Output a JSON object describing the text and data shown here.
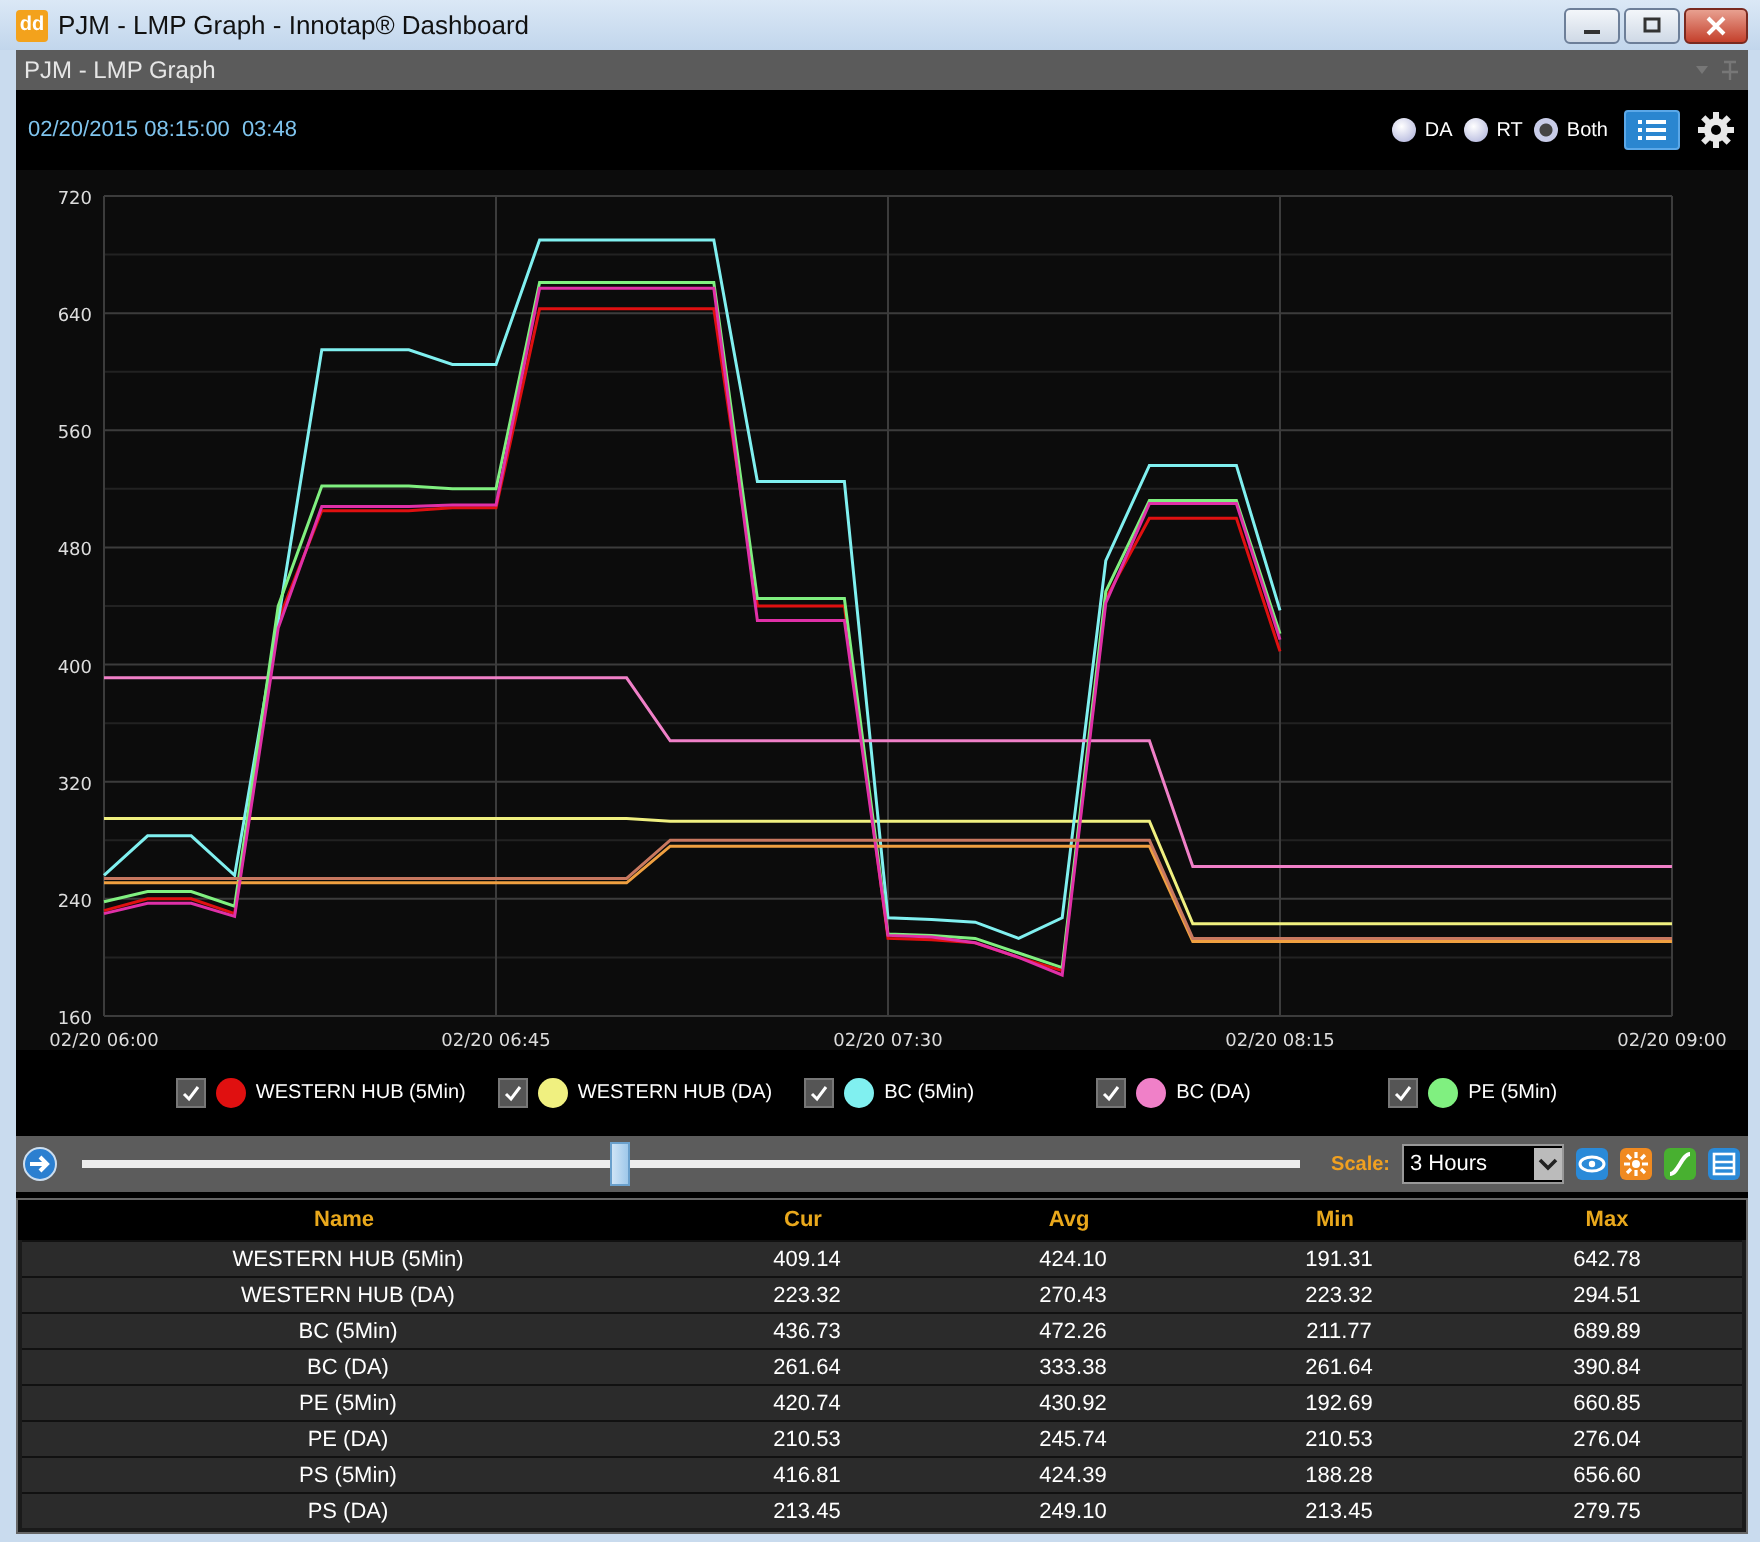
{
  "window": {
    "logo": "dd",
    "title": "PJM - LMP Graph - Innotap® Dashboard"
  },
  "panel": {
    "title": "PJM - LMP Graph"
  },
  "toolbar": {
    "timestamp": "02/20/2015 08:15:00",
    "elapsed": "03:48",
    "modes": [
      {
        "label": "DA",
        "selected": false
      },
      {
        "label": "RT",
        "selected": false
      },
      {
        "label": "Both",
        "selected": true
      }
    ]
  },
  "chart_data": {
    "type": "line",
    "categories": [
      "02/20 06:00",
      null,
      null,
      null,
      null,
      null,
      null,
      null,
      null,
      "02/20 06:45",
      null,
      null,
      null,
      null,
      null,
      null,
      null,
      null,
      "02/20 07:30",
      null,
      null,
      null,
      null,
      null,
      null,
      null,
      null,
      "02/20 08:15",
      null,
      null,
      null,
      null,
      null,
      null,
      null,
      null,
      "02/20 09:00"
    ],
    "ylim": [
      160,
      720
    ],
    "grid": true,
    "yticks": [
      160,
      240,
      320,
      400,
      480,
      560,
      640,
      720
    ],
    "series": [
      {
        "name": "WESTERN HUB (5Min)",
        "color": "#e01010",
        "values": [
          232,
          240,
          240,
          230,
          430,
          505,
          505,
          505,
          507,
          507,
          643,
          643,
          643,
          643,
          643,
          440,
          440,
          440,
          213,
          212,
          210,
          200,
          191,
          445,
          500,
          500,
          500,
          409,
          null,
          null,
          null,
          null,
          null,
          null,
          null,
          null,
          null
        ]
      },
      {
        "name": "WESTERN HUB (DA)",
        "color": "#f0f080",
        "values": [
          295,
          295,
          295,
          295,
          295,
          295,
          295,
          295,
          295,
          295,
          295,
          295,
          295,
          293,
          293,
          293,
          293,
          293,
          293,
          293,
          293,
          293,
          293,
          293,
          293,
          223,
          223,
          223,
          223,
          223,
          223,
          223,
          223,
          223,
          223,
          223,
          223
        ]
      },
      {
        "name": "BC (5Min)",
        "color": "#80f0f0",
        "values": [
          256,
          283,
          283,
          256,
          430,
          615,
          615,
          615,
          605,
          605,
          690,
          690,
          690,
          690,
          690,
          525,
          525,
          525,
          227,
          226,
          224,
          213,
          227,
          471,
          536,
          536,
          536,
          437,
          null,
          null,
          null,
          null,
          null,
          null,
          null,
          null,
          null
        ]
      },
      {
        "name": "BC (DA)",
        "color": "#f080c8",
        "values": [
          391,
          391,
          391,
          391,
          391,
          391,
          391,
          391,
          391,
          391,
          391,
          391,
          391,
          348,
          348,
          348,
          348,
          348,
          348,
          348,
          348,
          348,
          348,
          348,
          348,
          262,
          262,
          262,
          262,
          262,
          262,
          262,
          262,
          262,
          262,
          262,
          262
        ]
      },
      {
        "name": "PE (5Min)",
        "color": "#80f080",
        "values": [
          238,
          245,
          245,
          235,
          440,
          522,
          522,
          522,
          520,
          520,
          661,
          661,
          661,
          661,
          661,
          445,
          445,
          445,
          216,
          215,
          213,
          203,
          193,
          450,
          512,
          512,
          512,
          421,
          null,
          null,
          null,
          null,
          null,
          null,
          null,
          null,
          null
        ]
      },
      {
        "color": "#f0a040",
        "values": [
          251,
          251,
          251,
          251,
          251,
          251,
          251,
          251,
          251,
          251,
          251,
          251,
          251,
          276,
          276,
          276,
          276,
          276,
          276,
          276,
          276,
          276,
          276,
          276,
          276,
          211,
          211,
          211,
          211,
          211,
          211,
          211,
          211,
          211,
          211,
          211,
          211
        ]
      },
      {
        "color": "#e030a8",
        "values": [
          230,
          237,
          237,
          228,
          425,
          508,
          508,
          508,
          509,
          509,
          657,
          657,
          657,
          657,
          657,
          430,
          430,
          430,
          215,
          214,
          210,
          200,
          188,
          442,
          510,
          510,
          510,
          417,
          null,
          null,
          null,
          null,
          null,
          null,
          null,
          null,
          null
        ]
      },
      {
        "color": "#c87860",
        "values": [
          254,
          254,
          254,
          254,
          254,
          254,
          254,
          254,
          254,
          254,
          254,
          254,
          254,
          280,
          280,
          280,
          280,
          280,
          280,
          280,
          280,
          280,
          280,
          280,
          280,
          213,
          213,
          213,
          213,
          213,
          213,
          213,
          213,
          213,
          213,
          213,
          213
        ]
      }
    ]
  },
  "legend": [
    {
      "checked": true
    },
    {
      "checked": true
    },
    {
      "checked": true
    },
    {
      "checked": true
    },
    {
      "checked": true
    }
  ],
  "timeline": {
    "level": 0.44,
    "scale_label": "Scale:",
    "scale": "3 Hours"
  },
  "table": {
    "columns": [
      "Name",
      "Cur",
      "Avg",
      "Min",
      "Max"
    ],
    "rows": [
      [
        "WESTERN HUB (5Min)",
        "409.14",
        "424.10",
        "191.31",
        "642.78"
      ],
      [
        "WESTERN HUB (DA)",
        "223.32",
        "270.43",
        "223.32",
        "294.51"
      ],
      [
        "BC (5Min)",
        "436.73",
        "472.26",
        "211.77",
        "689.89"
      ],
      [
        "BC (DA)",
        "261.64",
        "333.38",
        "261.64",
        "390.84"
      ],
      [
        "PE (5Min)",
        "420.74",
        "430.92",
        "192.69",
        "660.85"
      ],
      [
        "PE (DA)",
        "210.53",
        "245.74",
        "210.53",
        "276.04"
      ],
      [
        "PS (5Min)",
        "416.81",
        "424.39",
        "188.28",
        "656.60"
      ],
      [
        "PS (DA)",
        "213.45",
        "249.10",
        "213.45",
        "279.75"
      ]
    ]
  }
}
